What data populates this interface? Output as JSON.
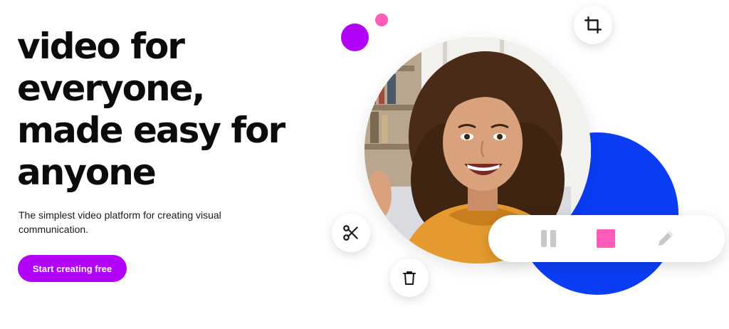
{
  "hero": {
    "title_lines": [
      "video for",
      "everyone,",
      "made easy for",
      "anyone"
    ],
    "subtitle": "The simplest video platform for creating visual communication.",
    "cta_label": "Start creating free"
  },
  "colors": {
    "brand_purple": "#b103f8",
    "accent_pink": "#ff5bb9",
    "accent_blue": "#0b3df5",
    "text_dark": "#0b0b0b"
  },
  "media": {
    "photo": "smiling-woman-curly-hair-orange-hoodie"
  },
  "tools": {
    "crop": "crop-icon",
    "cut": "scissors-icon",
    "delete": "trash-icon"
  },
  "controls": {
    "pause": "pause-icon",
    "stop": "stop-icon",
    "edit": "pencil-icon"
  }
}
